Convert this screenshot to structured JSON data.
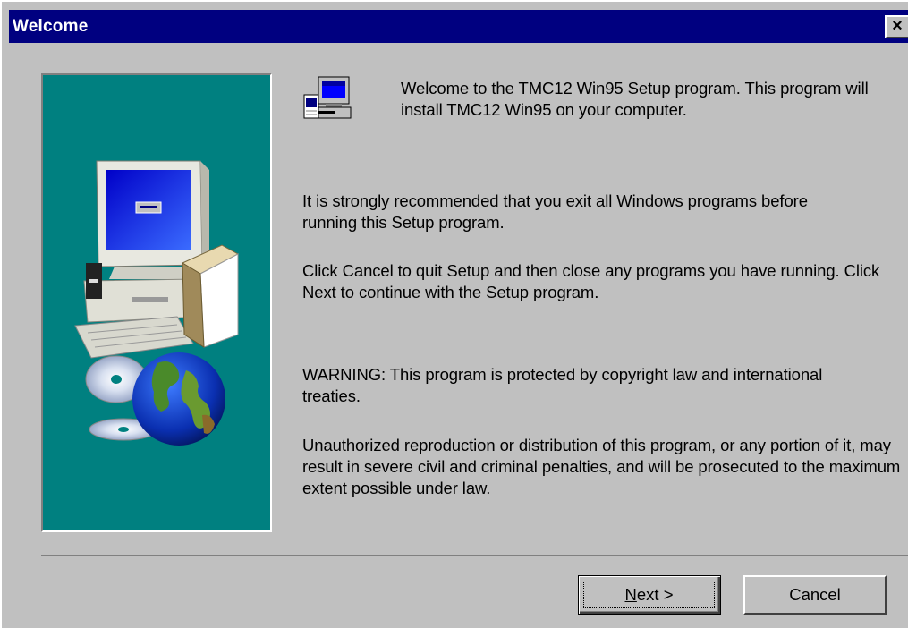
{
  "window": {
    "title": "Welcome",
    "close_label": "×"
  },
  "side_panel": {
    "image": "computer-cd-globe-illustration",
    "background": "#008080"
  },
  "content": {
    "setup_icon": "setup-computer-icon",
    "welcome_text": "Welcome to the TMC12 Win95 Setup program.  This program will install TMC12 Win95 on your computer.",
    "recommend_text": "It is strongly recommended that you exit all Windows programs before running this Setup program.",
    "cancel_text": "Click Cancel to quit Setup and then close any programs you have running.  Click Next to continue with the Setup program.",
    "warning_text": "WARNING: This program is protected by copyright law and international treaties.",
    "unauthorized_text": "Unauthorized reproduction or distribution of this program, or any portion of it, may result in severe civil and criminal penalties, and will be prosecuted to the maximum extent possible under law."
  },
  "buttons": {
    "next_mnemonic": "N",
    "next_rest": "ext >",
    "cancel_label": "Cancel"
  },
  "colors": {
    "titlebar": "#000080",
    "face": "#c0c0c0",
    "panel": "#008080"
  }
}
